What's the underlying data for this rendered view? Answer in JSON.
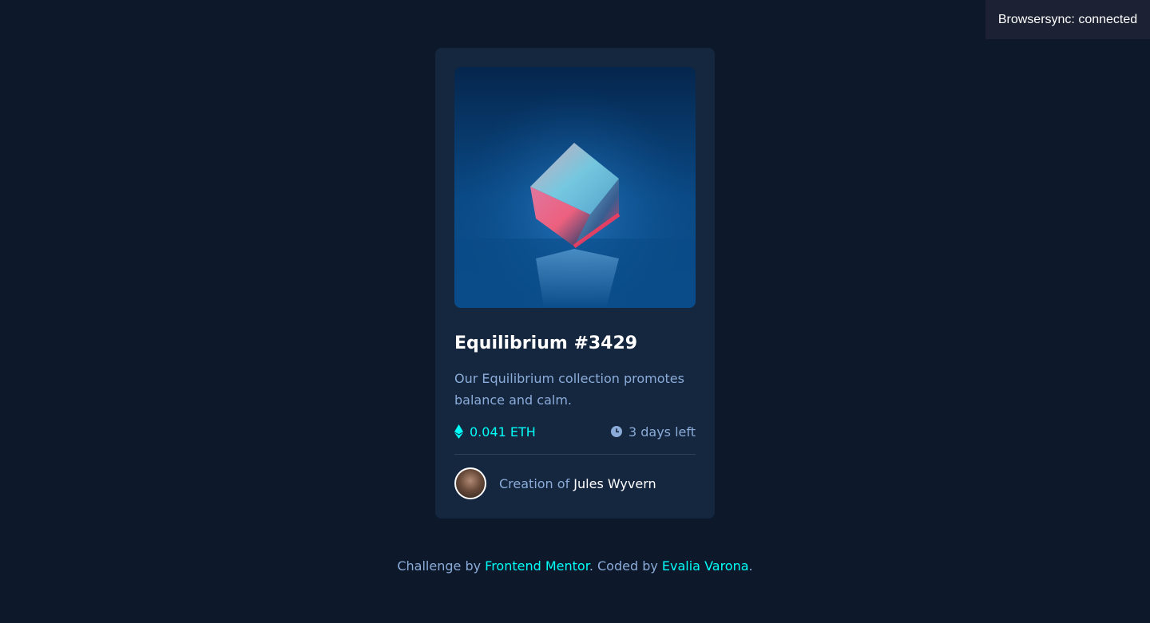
{
  "browsersync": {
    "message": "Browsersync: connected"
  },
  "card": {
    "image_alt": "Equilibrium cube image",
    "title": "Equilibrium #3429",
    "description": "Our Equilibrium collection promotes balance and calm.",
    "price": {
      "icon": "ethereum-icon",
      "value": "0.041 ETH"
    },
    "time": {
      "icon": "clock-icon",
      "value": "3 days left"
    },
    "creator": {
      "prefix": "Creation of",
      "name": "Jules Wyvern"
    }
  },
  "attribution": {
    "part1": "Challenge by",
    "link1": "Frontend Mentor",
    "part2": ". Coded by",
    "link2": "Evalia Varona",
    "part3": "."
  },
  "colors": {
    "background": "#0d192b",
    "card": "#15263f",
    "accent_cyan": "#00fff8",
    "soft_blue": "#8bacd9",
    "white": "#ffffff"
  }
}
